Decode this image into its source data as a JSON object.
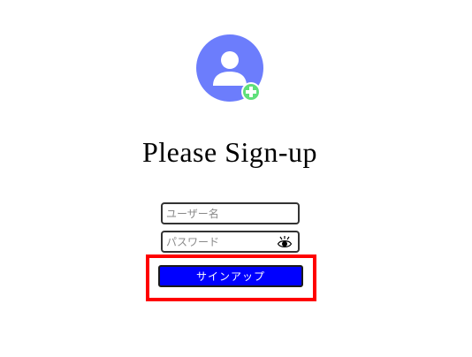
{
  "avatar": {
    "icon": "add-user-icon",
    "color": "#6c7dfc",
    "badge_color": "#5fe07a"
  },
  "header": {
    "title": "Please Sign-up"
  },
  "form": {
    "username_placeholder": "ユーザー名",
    "password_placeholder": "パスワード",
    "toggle_icon": "eye-icon",
    "submit_label": "サインアップ",
    "submit_color": "#0000ff"
  },
  "highlight_color": "#ff0000"
}
